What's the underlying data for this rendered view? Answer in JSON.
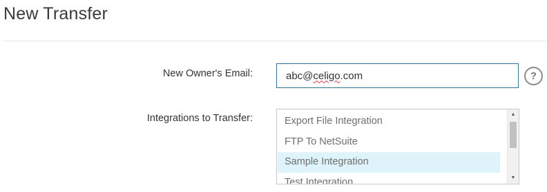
{
  "page": {
    "title": "New Transfer"
  },
  "form": {
    "email": {
      "label": "New Owner's Email:",
      "value_prefix": "abc@",
      "value_misspelled": "celigo",
      "value_suffix": ".com",
      "help_label": "?"
    },
    "integrations": {
      "label": "Integrations to Transfer:",
      "options": [
        "Export File Integration",
        "FTP To NetSuite",
        "Sample Integration",
        "Test Integration"
      ],
      "selected": "Sample Integration"
    }
  },
  "icons": {
    "help": "question-circle-icon",
    "scroll_up": "triangle-up-icon",
    "scroll_down": "triangle-down-icon"
  },
  "colors": {
    "input_border": "#2f6f8f",
    "selected_row": "#dff3fa",
    "spellcheck": "#d23b3b"
  }
}
